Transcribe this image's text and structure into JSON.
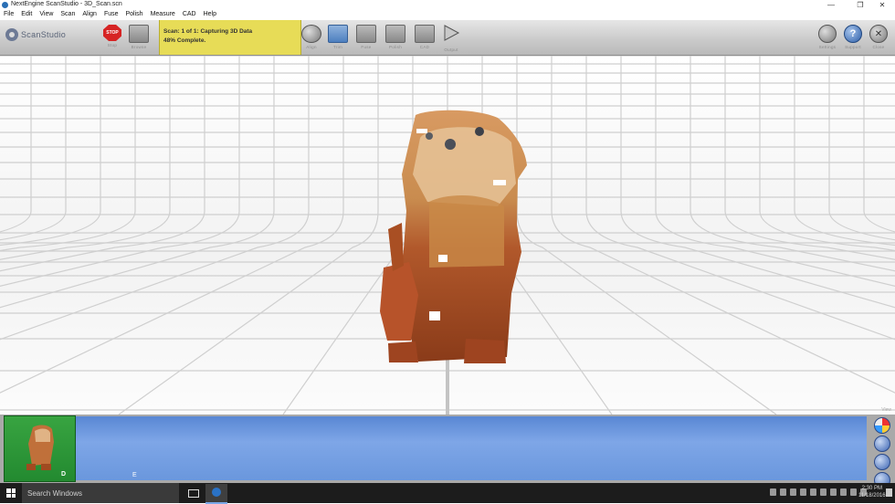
{
  "window": {
    "title": "NextEngine ScanStudio - 3D_Scan.scn",
    "min_glyph": "—",
    "max_glyph": "❐",
    "close_glyph": "✕"
  },
  "menu": [
    "File",
    "Edit",
    "View",
    "Scan",
    "Align",
    "Fuse",
    "Polish",
    "Measure",
    "CAD",
    "Help"
  ],
  "toolbar": {
    "logo_text": "ScanStudio",
    "stop_label": "Stop",
    "stop_glyph": "STOP",
    "browse_label": "Browse",
    "status_line1": "Scan: 1 of 1: Capturing 3D Data",
    "status_line2": "48% Complete.",
    "align_label": "Align",
    "trim_label": "Trim",
    "fuse_label": "Fuse",
    "polish_label": "Polish",
    "cad_label": "CAD",
    "output_label": "Output",
    "settings_label": "Settings",
    "support_label": "Support",
    "close_label": "Close"
  },
  "viewport": {
    "corner_label": "View"
  },
  "bottom": {
    "thumb_label": "D",
    "panel_label": "E"
  },
  "taskbar": {
    "search_placeholder": "Search Windows",
    "time": "2:30 PM",
    "date": "11/18/2016"
  },
  "colors": {
    "status_bg": "#e7dc57",
    "panel_blue": "#6a97dd",
    "thumb_green": "#2f9a3a"
  }
}
